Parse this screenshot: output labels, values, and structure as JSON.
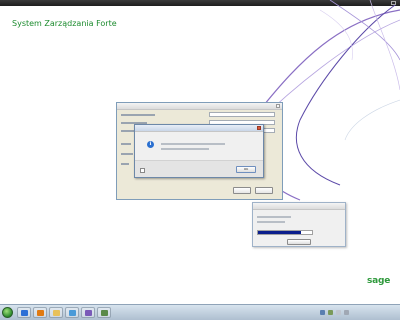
{
  "top_bar": {
    "left": "",
    "center": ""
  },
  "app_title": "System Zarządzania Forte",
  "main_dialog": {
    "title": "",
    "button_label": ""
  },
  "message_dialog": {
    "title": "",
    "message": "",
    "ok_label": "OK"
  },
  "progress_dialog": {
    "title": "",
    "text": "",
    "percent": "",
    "progress": 0.8,
    "button_label": ""
  },
  "logo": {
    "brand": "sage",
    "tagline": ""
  },
  "taskbar": {
    "items": [
      {
        "icon": "ie-icon",
        "color": "#2c6fd6"
      },
      {
        "icon": "media-player-icon",
        "color": "#e07a12"
      },
      {
        "icon": "folder-icon",
        "color": "#e8c15a"
      },
      {
        "icon": "play-icon",
        "color": "#4a9ad8"
      },
      {
        "icon": "app-icon",
        "color": "#7a5ab8"
      },
      {
        "icon": "app-icon-2",
        "color": "#5a8a4a"
      }
    ],
    "clock": ""
  },
  "colors": {
    "title_green": "#1c8b2e",
    "progress_fill": "#0b1e8c",
    "sage_green": "#2f9a3c"
  }
}
